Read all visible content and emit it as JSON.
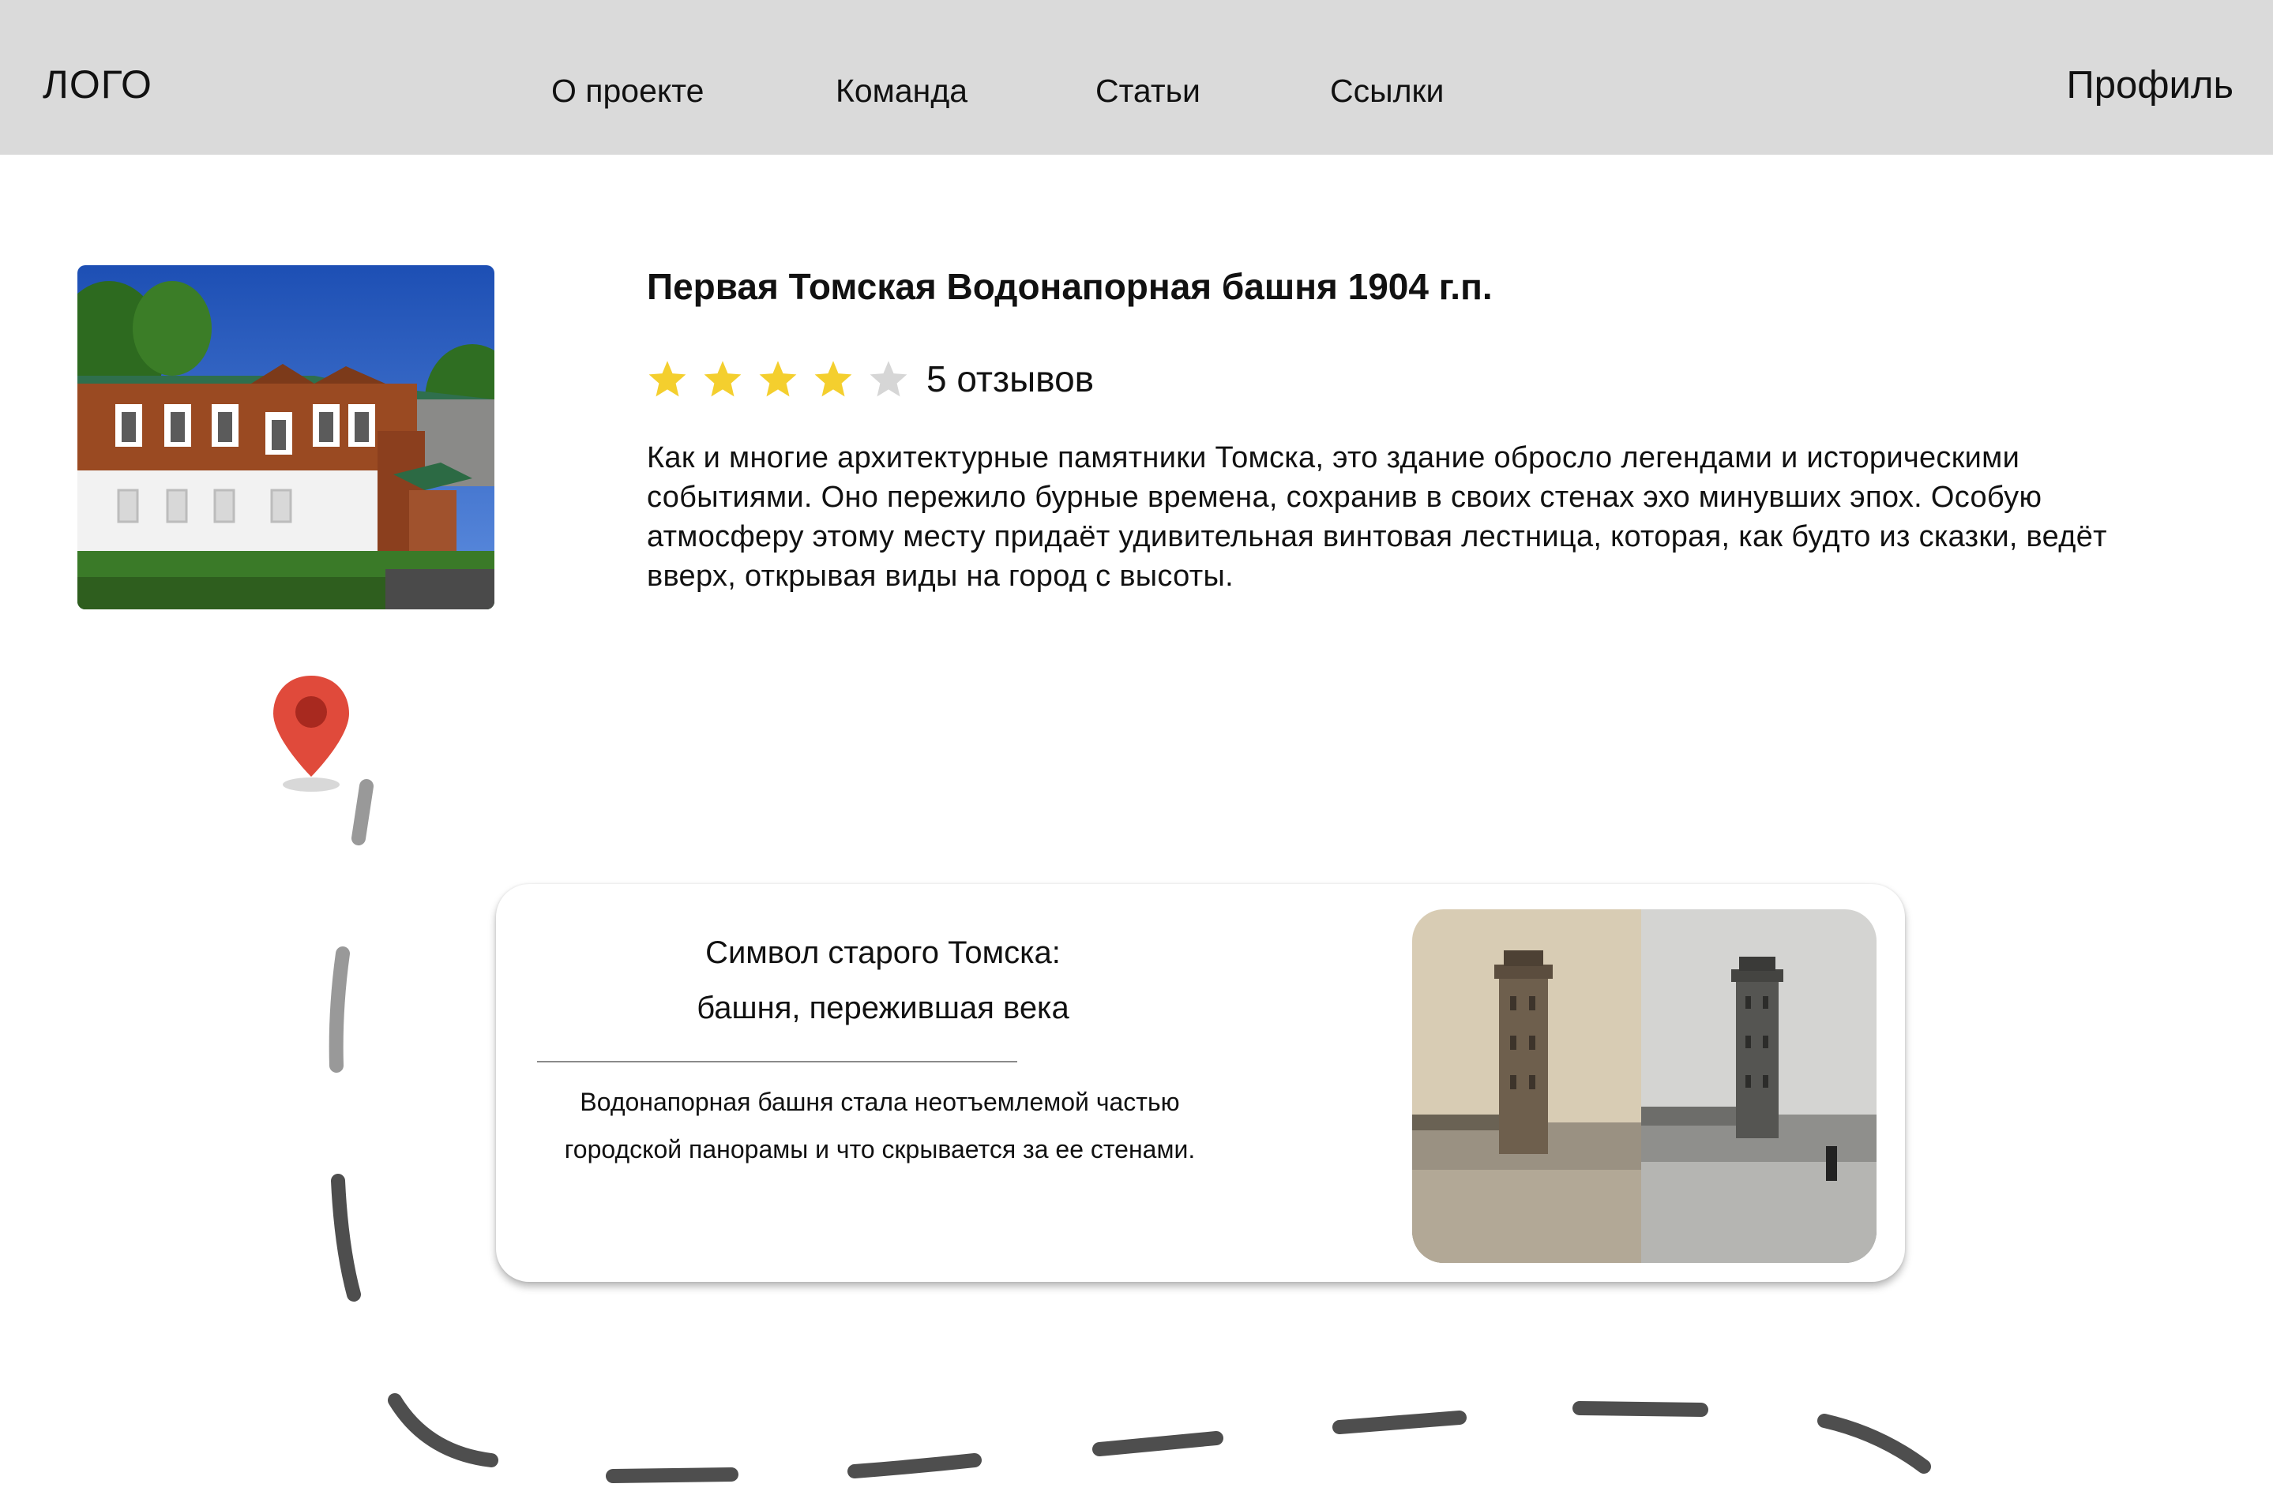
{
  "header": {
    "logo": "ЛОГО",
    "nav": [
      "О проекте",
      "Команда",
      "Статьи",
      "Ссылки"
    ],
    "profile": "Профиль"
  },
  "hero": {
    "title": "Первая Томская Водонапорная башня 1904 г.п.",
    "rating": 4,
    "rating_max": 5,
    "reviews_label": "5 отзывов",
    "star_color": "#f4cf2e",
    "star_empty_color": "#d6d6d6",
    "description": "Как и многие архитектурные памятники Томска, это здание обросло легендами и историческими событиями. Оно пережило бурные времена, сохранив в своих стенах эхо минувших эпох. Особую атмосферу этому месту придаёт удивительная винтовая лестница, которая, как будто из сказки, ведёт вверх, открывая виды на город с высоты."
  },
  "map_pin": {
    "icon": "map-pin-icon",
    "color": "#e04a3b"
  },
  "card": {
    "heading_line1": "Символ старого Томска:",
    "heading_line2": "башня, пережившая века",
    "text": "Водонапорная башня стала неотъемлемой частью городской панорамы и что скрывается за ее стенами."
  }
}
